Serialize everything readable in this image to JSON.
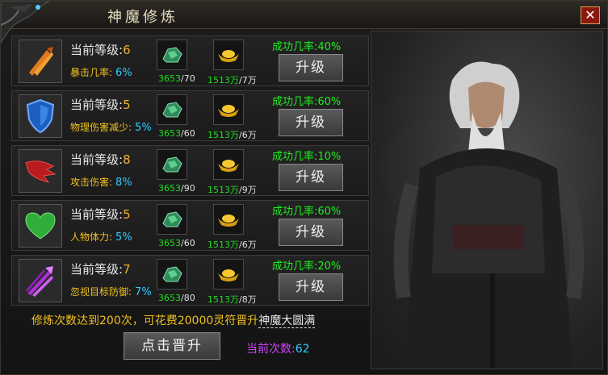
{
  "window": {
    "title": "神魔修炼",
    "close_label": "✕"
  },
  "skills": [
    {
      "icon": "flame-arrows-icon",
      "level_label": "当前等级:",
      "level": "6",
      "stat_label": "暴击几率:",
      "stat_value": "6%",
      "item_have": "3653",
      "item_need": "/70",
      "gold_have": "1513万",
      "gold_need": "/7万",
      "rate": "成功几率:40%",
      "button": "升级"
    },
    {
      "icon": "blue-shield-icon",
      "level_label": "当前等级:",
      "level": "5",
      "stat_label": "物理伤害减少:",
      "stat_value": "5%",
      "item_have": "3653",
      "item_need": "/60",
      "gold_have": "1513万",
      "gold_need": "/6万",
      "rate": "成功几率:60%",
      "button": "升级"
    },
    {
      "icon": "red-wing-icon",
      "level_label": "当前等级:",
      "level": "8",
      "stat_label": "攻击伤害:",
      "stat_value": "8%",
      "item_have": "3653",
      "item_need": "/90",
      "gold_have": "1513万",
      "gold_need": "/9万",
      "rate": "成功几率:10%",
      "button": "升级"
    },
    {
      "icon": "green-heart-icon",
      "level_label": "当前等级:",
      "level": "5",
      "stat_label": "人物体力:",
      "stat_value": "5%",
      "item_have": "3653",
      "item_need": "/60",
      "gold_have": "1513万",
      "gold_need": "/6万",
      "rate": "成功几率:60%",
      "button": "升级"
    },
    {
      "icon": "purple-arrows-icon",
      "level_label": "当前等级:",
      "level": "7",
      "stat_label": "忽视目标防御:",
      "stat_value": "7%",
      "item_have": "3653",
      "item_need": "/80",
      "gold_have": "1513万",
      "gold_need": "/8万",
      "rate": "成功几率:20%",
      "button": "升级"
    }
  ],
  "footer": {
    "notice_prefix": "修炼次数达到200次，可花费20000灵符晋升",
    "notice_highlight": "神魔大圆满",
    "promote_button": "点击晋升",
    "count_label": "当前次数:",
    "count_value": "62"
  },
  "colors": {
    "success_rate": "#22ee22",
    "level_number": "#f0b030",
    "stat_percent": "#33ccff",
    "count_label": "#cc44ff"
  }
}
